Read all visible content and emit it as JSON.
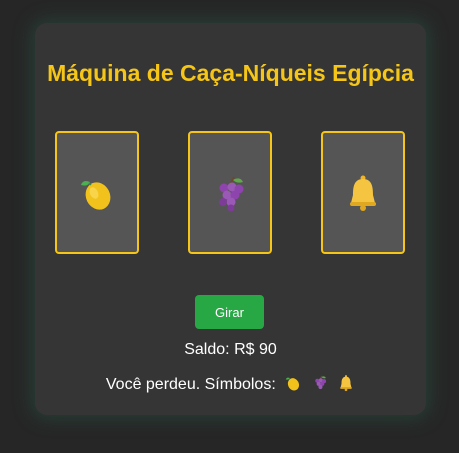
{
  "game": {
    "title": "Máquina de Caça-Níqueis Egípcia",
    "reels": [
      {
        "symbol": "lemon-icon"
      },
      {
        "symbol": "grapes-icon"
      },
      {
        "symbol": "bell-icon"
      }
    ],
    "spin_label": "Girar",
    "balance_label": "Saldo:",
    "balance_value": "R$ 90",
    "result_text": "Você perdeu. Símbolos:",
    "result_symbols": [
      "lemon-icon",
      "grapes-icon",
      "bell-icon"
    ]
  },
  "colors": {
    "accent": "#f5c518",
    "button": "#28a745",
    "panel": "#353535",
    "reel": "#555555"
  }
}
